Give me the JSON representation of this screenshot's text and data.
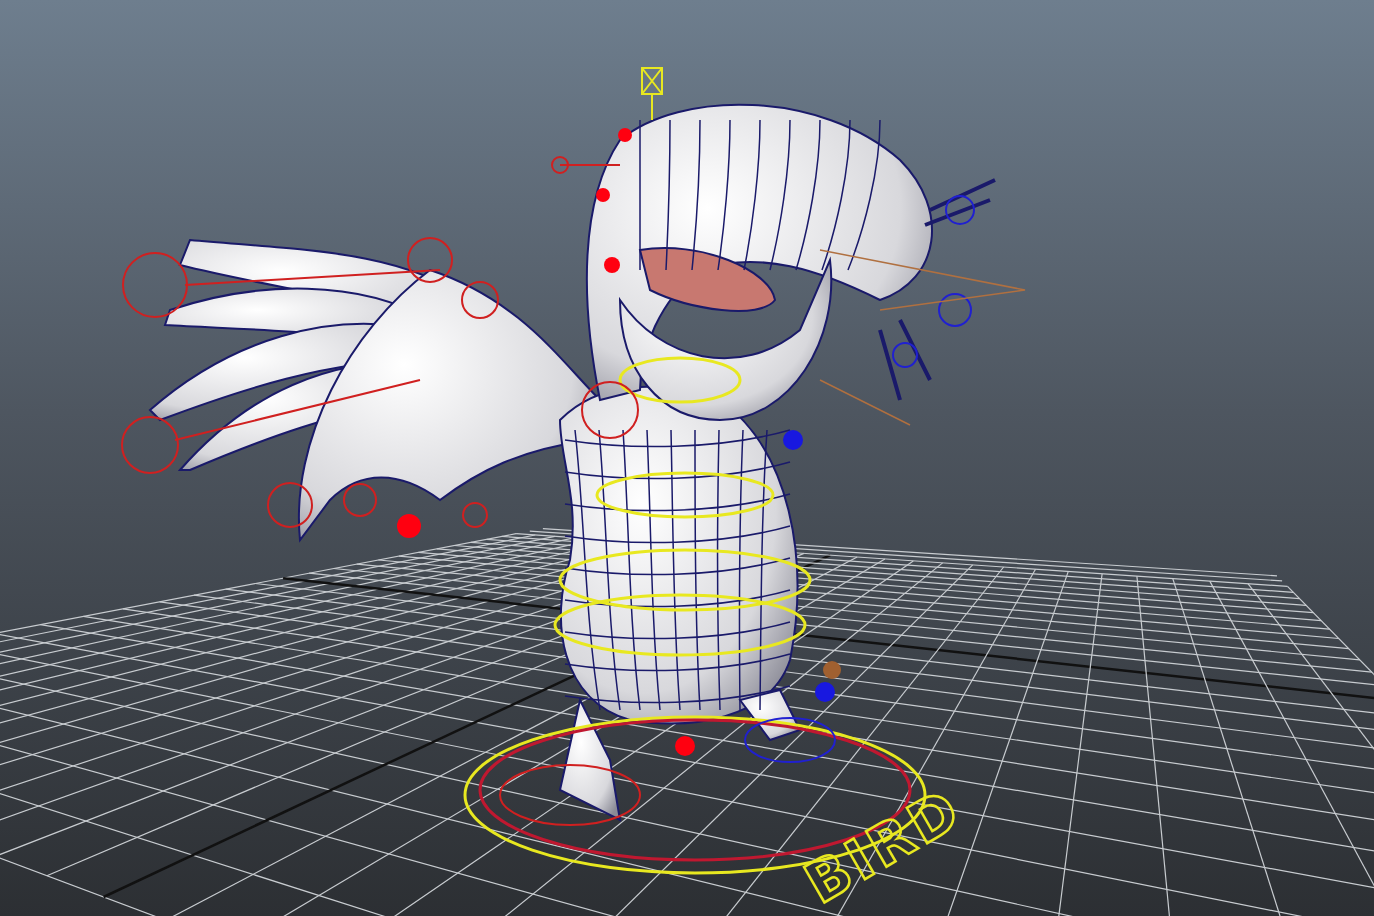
{
  "viewport": {
    "ground_label": "BIRD"
  }
}
